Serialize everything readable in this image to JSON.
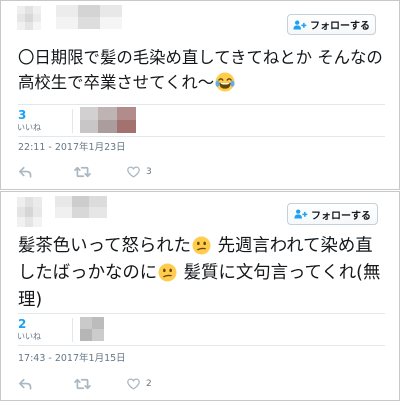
{
  "theme": {
    "accent_color": "#1da1f2",
    "icon_color": "#aab8c2",
    "muted_text_color": "#657786"
  },
  "tweets": [
    {
      "follow_button": {
        "label": "フォローする",
        "icon": "follow-person-plus-icon"
      },
      "text_lines": [
        [
          {
            "text": "〇日期限で髪の毛染め直してきてねとか そんなの"
          }
        ],
        [
          {
            "text": "高校生で卒業させてくれ〜"
          },
          {
            "emoji": "face-with-tears-of-joy"
          }
        ]
      ],
      "likes": {
        "count": "3",
        "label": "いいね"
      },
      "timestamp": "22:11 - 2017年1月23日",
      "actions": {
        "reply_icon": "reply-icon",
        "retweet_icon": "retweet-icon",
        "like_icon": "heart-icon",
        "like_count": "3"
      }
    },
    {
      "follow_button": {
        "label": "フォローする",
        "icon": "follow-person-plus-icon"
      },
      "text_lines": [
        [
          {
            "text": "髪茶色いって怒られた"
          },
          {
            "emoji": "confused-face"
          },
          {
            "text": " 先週言われて染め直"
          }
        ],
        [
          {
            "text": "したばっかなのに"
          },
          {
            "emoji": "confused-face"
          },
          {
            "text": " 髪質に文句言ってくれ(無"
          }
        ],
        [
          {
            "text": "理)"
          }
        ]
      ],
      "likes": {
        "count": "2",
        "label": "いいね"
      },
      "timestamp": "17:43 - 2017年1月15日",
      "actions": {
        "reply_icon": "reply-icon",
        "retweet_icon": "retweet-icon",
        "like_icon": "heart-icon",
        "like_count": "2"
      }
    }
  ]
}
